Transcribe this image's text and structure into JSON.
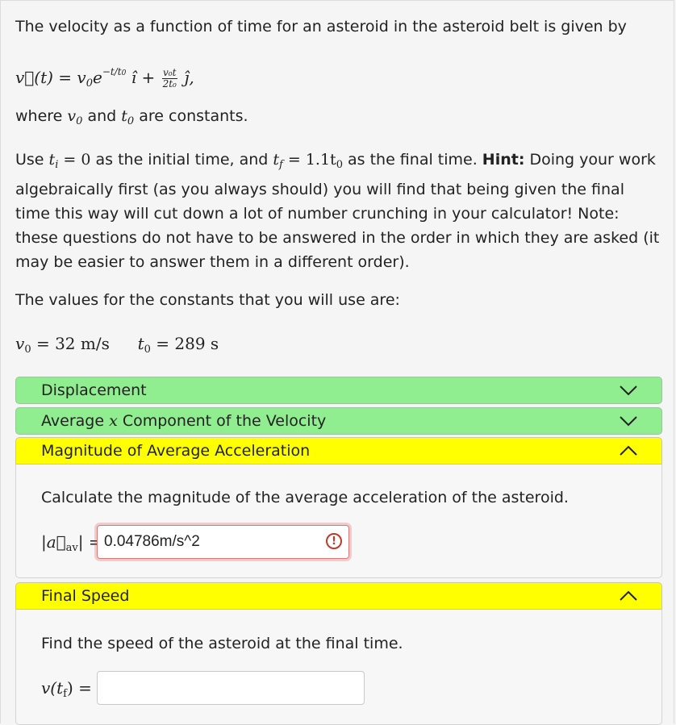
{
  "intro": "The velocity as a function of time for an asteroid in the asteroid belt is given by",
  "equation": {
    "lhs": "v⃗(t) = v",
    "sub0": "0",
    "e": "e",
    "exp": "−t/t",
    "exp_sub": "0",
    "ihat": "ı̂ +",
    "frac_num": "v₀t",
    "frac_den": "2t₀",
    "jhat": "ȷ̂,"
  },
  "where_text": {
    "pre": "where",
    "v0": "v",
    "v0_sub": "0",
    "and": "and",
    "t0": "t",
    "t0_sub": "0",
    "post": "are constants."
  },
  "use_para": {
    "p1": "Use",
    "ti": "t",
    "ti_sub": "i",
    "ti_val": " = 0",
    "p2": " as the initial time, and ",
    "tf": "t",
    "tf_sub": "f",
    "tf_val": " = 1.1t",
    "tf_val_sub": "0",
    "p3": " as the final time. ",
    "hint": "Hint:",
    "p4": " Doing your work algebraically first (as you always should) you will find that being given the final time this way will cut down a lot of number crunching in your calculator! Note: these questions do not have to be answered in the order in which they are asked (it may be easier to answer them in a different order)."
  },
  "values_intro": "The values for the constants that you will use are:",
  "constants": {
    "v0_sym": "v",
    "v0_sub": "0",
    "v0_val": " = 32 m/s",
    "t0_sym": "t",
    "t0_sub": "0",
    "t0_val": " = 289 s"
  },
  "sections": {
    "displacement": "Displacement",
    "avg_x_pre": "Average ",
    "avg_x_var": "x",
    "avg_x_post": " Component of the Velocity",
    "avg_accel": "Magnitude of Average Acceleration",
    "final_speed": "Final Speed"
  },
  "accel_panel": {
    "question": "Calculate the magnitude of the average acceleration of the asteroid.",
    "label": "|a⃗",
    "label_sub": "av",
    "label_end": "| =",
    "answer_value": "0.04786m/s^2",
    "warn_icon": "!"
  },
  "speed_panel": {
    "question": "Find the speed of the asteroid at the final time.",
    "label": "v(t",
    "label_sub": "f",
    "label_end": ") =",
    "answer_value": ""
  },
  "colors": {
    "complete": "#90ee90",
    "open": "#ffff00",
    "error": "#c0392b"
  }
}
